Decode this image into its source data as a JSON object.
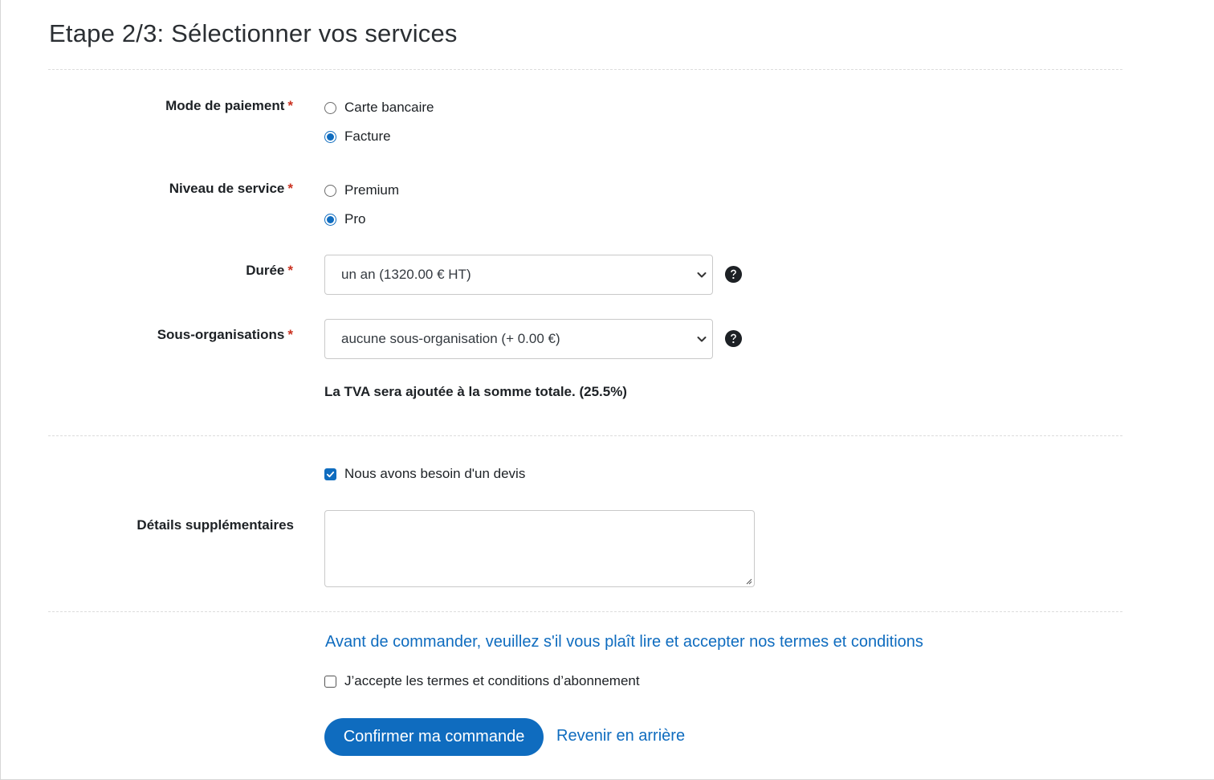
{
  "title": "Etape 2/3: Sélectionner vos services",
  "payment": {
    "label": "Mode de paiement",
    "required": "*",
    "options": [
      {
        "label": "Carte bancaire",
        "checked": false
      },
      {
        "label": "Facture",
        "checked": true
      }
    ]
  },
  "service_level": {
    "label": "Niveau de service",
    "required": "*",
    "options": [
      {
        "label": "Premium",
        "checked": false
      },
      {
        "label": "Pro",
        "checked": true
      }
    ]
  },
  "duration": {
    "label": "Durée",
    "required": "*",
    "selected": "un an (1320.00 € HT)",
    "help_icon": "question-circle-icon"
  },
  "sub_orgs": {
    "label": "Sous-organisations",
    "required": "*",
    "selected": "aucune sous-organisation (+ 0.00 €)",
    "help_icon": "question-circle-icon"
  },
  "vat_note": "La TVA sera ajoutée à la somme totale. (25.5%)",
  "quote_checkbox": {
    "label": "Nous avons besoin d'un devis",
    "checked": true
  },
  "details": {
    "label": "Détails supplémentaires",
    "value": ""
  },
  "terms_link": "Avant de commander, veuillez s'il vous plaît lire et accepter nos termes et conditions",
  "accept_checkbox": {
    "label": "J’accepte les termes et conditions d’abonnement",
    "checked": false
  },
  "confirm_button": "Confirmer ma commande",
  "back_link": "Revenir en arrière",
  "colors": {
    "accent": "#0f6cbf",
    "required": "#ca3120",
    "text": "#1d2125"
  }
}
